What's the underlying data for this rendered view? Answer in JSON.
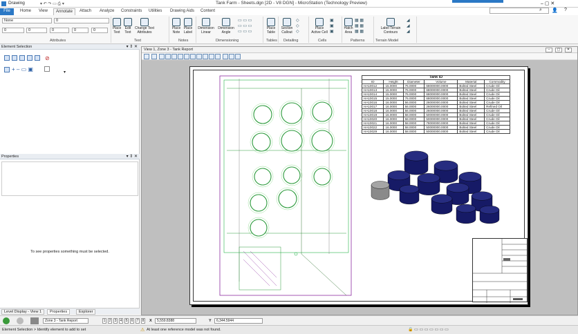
{
  "app": {
    "workflow": "Drawing",
    "window_title": "Tank Farm - Sheets.dgn [2D - V8 DGN] - MicroStation (Technology Preview)"
  },
  "ribbon_tabs": [
    "File",
    "Home",
    "View",
    "Annotate",
    "Attach",
    "Analyze",
    "Constraints",
    "Utilities",
    "Drawing Aids",
    "Content"
  ],
  "active_tab": "Annotate",
  "attributes": {
    "level": "None",
    "weight": "0",
    "group_label": "Attributes"
  },
  "ribbon_buttons": {
    "place_text": "Place Text",
    "edit_text": "Edit Text",
    "change_text_attributes": "Change Text Attributes",
    "place_note": "Place Note",
    "place_label": "Place Label",
    "dimension_linear": "Dimension Linear",
    "dimension_angle": "Dimension Angle",
    "place_table": "Place Table",
    "section_callout": "Section Callout",
    "place_active_cell": "Place Active Cell",
    "hatch_area": "Hatch Area",
    "label_terrain_contours": "Label Terrain Contours"
  },
  "ribbon_groups": [
    "Text",
    "Notes",
    "Dimensioning",
    "Tables",
    "Detailing",
    "Cells",
    "Patterns",
    "Terrain Model"
  ],
  "panels": {
    "element_selection": "Element Selection",
    "properties": "Properties",
    "properties_hint": "To see properties something must be selected."
  },
  "left_tabs": [
    "Level Display - View 1",
    "Properties",
    "Explorer"
  ],
  "view": {
    "title": "View 1, Zone 3 - Tank Report"
  },
  "tank_table": {
    "title": "Tank ID",
    "headers": [
      "ID",
      "Height",
      "Diameter",
      "Volume",
      "Material",
      "Commodity"
    ],
    "rows": [
      [
        "HA10012",
        "15.0000",
        "76.0000",
        "68000000.0000",
        "Bolted Steel",
        "Crude Oil"
      ],
      [
        "HA10013",
        "15.0000",
        "76.0000",
        "68000000.0000",
        "Bolted Steel",
        "Crude Oil"
      ],
      [
        "HA10014",
        "15.0000",
        "76.0000",
        "68000000.0000",
        "Bolted Steel",
        "Crude Oil"
      ],
      [
        "HA10015",
        "15.0000",
        "76.0000",
        "68000000.0000",
        "Bolted Steel",
        "Crude Oil"
      ],
      [
        "HA10016",
        "16.0000",
        "56.0000",
        "26000000.0000",
        "Bolted Steel",
        "Crude Oil"
      ],
      [
        "HA10017",
        "16.0000",
        "56.0000",
        "26000000.0000",
        "Bolted Steel",
        "Refined Oil"
      ],
      [
        "HA10018",
        "16.0000",
        "56.0000",
        "26000000.0000",
        "Bolted Steel",
        "Crude Oil"
      ],
      [
        "HA10019",
        "16.0000",
        "58.0000",
        "50000000.0000",
        "Bolted Steel",
        "Crude Oil"
      ],
      [
        "HA10020",
        "16.0000",
        "58.0000",
        "50000000.0000",
        "Bolted Steel",
        "Crude Oil"
      ],
      [
        "HA10021",
        "16.0000",
        "58.0000",
        "78000000.0000",
        "Bolted Steel",
        "Crude Oil"
      ],
      [
        "HA10022",
        "16.0000",
        "58.0000",
        "50000000.0000",
        "Bolted Steel",
        "Crude Oil"
      ],
      [
        "HA10029",
        "16.0000",
        "58.0000",
        "50000000.0000",
        "Bolted Steel",
        "Crude Oil"
      ]
    ]
  },
  "statusbar": {
    "zone": "Zone 3 - Tank Report",
    "view_numbers": [
      "1",
      "2",
      "3",
      "4",
      "5",
      "6",
      "7",
      "8"
    ],
    "x_label": "X",
    "x_value": "5,559.8388",
    "y_label": "Y",
    "y_value": "6,344.5944",
    "prompt": "Element Selection > Identify element to add to set",
    "message": "At least one reference model was not found."
  },
  "colors": {
    "accent": "#2b78c5",
    "tank": "#161a66",
    "tank_grey": "#8a8a8a",
    "site_green": "#25b34a",
    "site_purple": "#8c2aa0"
  }
}
